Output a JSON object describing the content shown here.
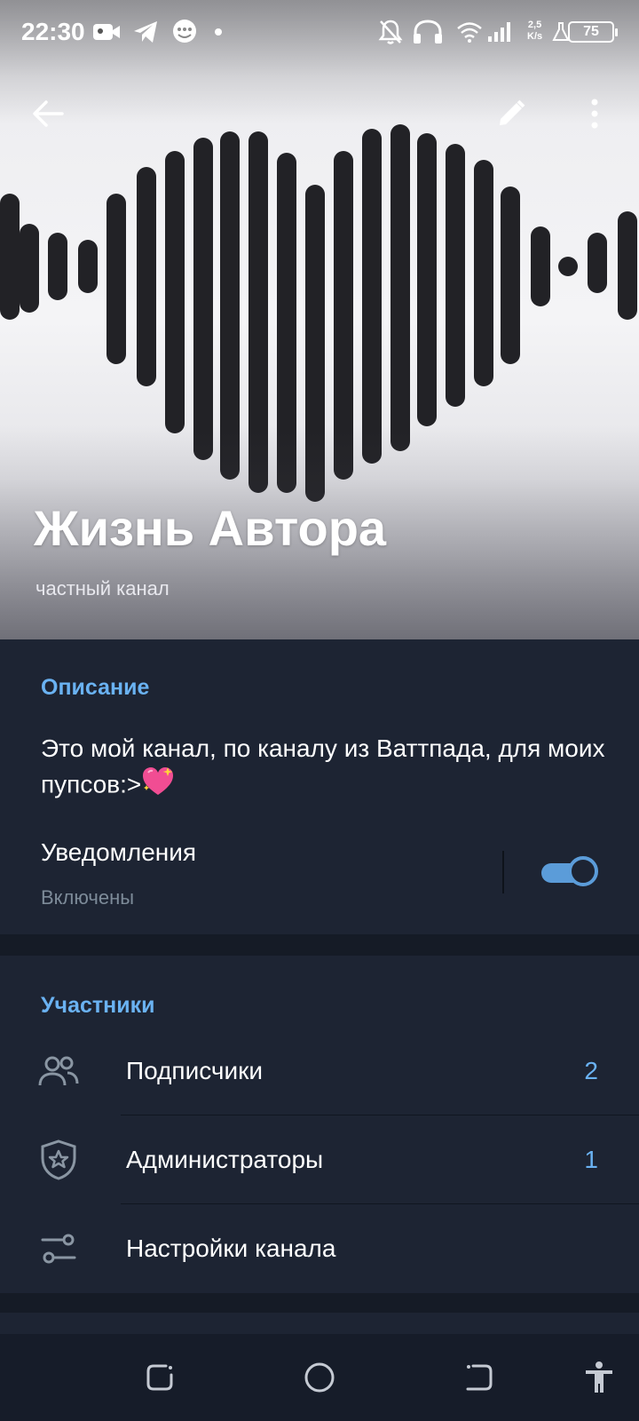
{
  "status_bar": {
    "time": "22:30",
    "net_speed_value": "2,5",
    "net_speed_unit": "K/s",
    "battery": "75",
    "icons": [
      "video-camera-icon",
      "telegram-icon",
      "chat-bubble-icon",
      "dot-icon",
      "bell-off-icon",
      "headphones-icon",
      "wifi-icon",
      "signal-icon",
      "flask-icon",
      "battery-icon"
    ]
  },
  "toolbar": {
    "back_icon": "arrow-left-icon",
    "edit_icon": "pencil-icon",
    "more_icon": "more-vertical-icon"
  },
  "channel": {
    "title": "Жизнь Автора",
    "subtitle": "частный канал"
  },
  "description": {
    "section_title": "Описание",
    "text": "Это мой канал, по каналу из Ваттпада, для моих пупсов:>",
    "emoji": "sparkling-heart-emoji"
  },
  "notifications": {
    "label": "Уведомления",
    "status": "Включены",
    "enabled": true
  },
  "members": {
    "section_title": "Участники",
    "rows": [
      {
        "label": "Подписчики",
        "count": "2",
        "icon": "users-icon"
      },
      {
        "label": "Администраторы",
        "count": "1",
        "icon": "shield-star-icon"
      },
      {
        "label": "Настройки канала",
        "count": "",
        "icon": "sliders-icon"
      }
    ]
  },
  "colors": {
    "background": "#1d2433",
    "accent": "#6ab2f2",
    "toggle": "#5b9cd9",
    "muted_text": "#7d8b99",
    "divider": "#151b26"
  },
  "nav_bar": {
    "icons": [
      "recents-icon",
      "home-icon",
      "back-nav-icon",
      "accessibility-icon"
    ]
  }
}
